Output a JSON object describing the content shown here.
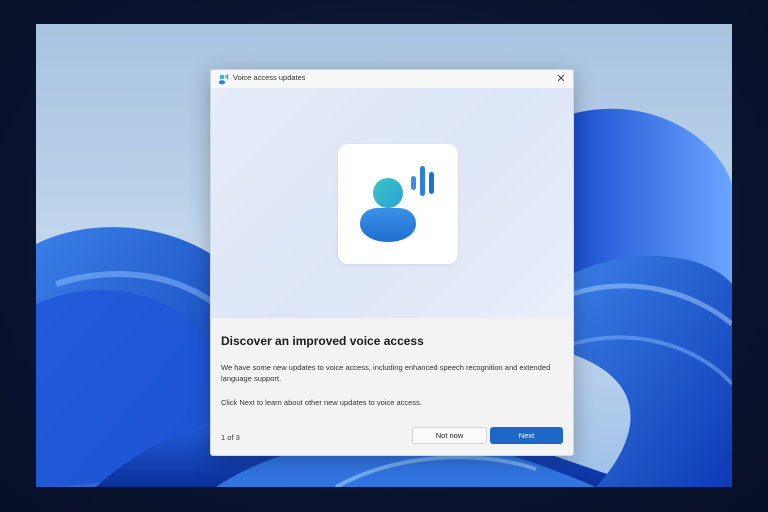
{
  "dialog": {
    "title": "Voice access updates",
    "close_glyph": "✕",
    "heading": "Discover an improved voice access",
    "body_paragraph_1": "We have some new updates to voice access, including enhanced speech recognition and extended language support.",
    "body_paragraph_2": "Click Next to learn about other new updates to voice access.",
    "page_indicator": "1 of 3",
    "buttons": {
      "secondary_label": "Not now",
      "primary_label": "Next"
    },
    "hero_icon": "voice-access-icon"
  },
  "colors": {
    "primary_button": "#1f67c4",
    "icon_teal": "#36b6c7",
    "icon_blue": "#2f7fd8"
  }
}
